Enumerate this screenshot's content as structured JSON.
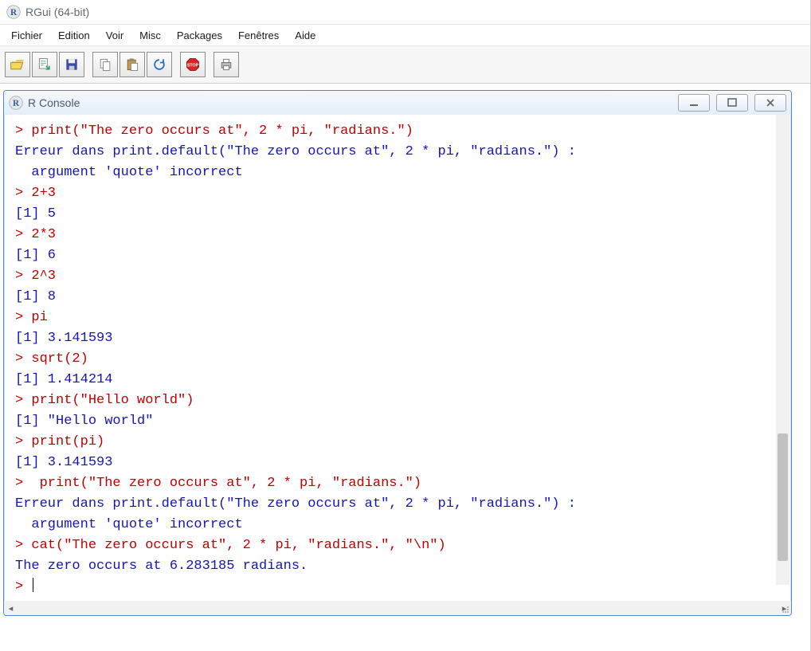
{
  "app": {
    "title": "RGui (64-bit)"
  },
  "menu": [
    "Fichier",
    "Edition",
    "Voir",
    "Misc",
    "Packages",
    "Fenêtres",
    "Aide"
  ],
  "toolbar_icons": [
    "open-icon",
    "source-icon",
    "save-icon",
    "copy-icon",
    "paste-icon",
    "refresh-icon",
    "stop-icon",
    "print-icon"
  ],
  "console_window": {
    "title": "R Console"
  },
  "prompt": "> ",
  "console_lines": [
    {
      "segs": [
        {
          "c": "red",
          "t": "> print(\"The zero occurs at\", 2 * pi, \"radians.\")"
        }
      ]
    },
    {
      "segs": [
        {
          "c": "blue",
          "t": "Erreur dans print.default(\"The zero occurs at\", 2 * pi, \"radians.\") : "
        }
      ]
    },
    {
      "segs": [
        {
          "c": "blue",
          "t": "  argument 'quote' incorrect"
        }
      ]
    },
    {
      "segs": [
        {
          "c": "red",
          "t": "> 2+3"
        }
      ]
    },
    {
      "segs": [
        {
          "c": "blue",
          "t": "[1] 5"
        }
      ]
    },
    {
      "segs": [
        {
          "c": "red",
          "t": "> 2*3"
        }
      ]
    },
    {
      "segs": [
        {
          "c": "blue",
          "t": "[1] 6"
        }
      ]
    },
    {
      "segs": [
        {
          "c": "red",
          "t": "> 2^3"
        }
      ]
    },
    {
      "segs": [
        {
          "c": "blue",
          "t": "[1] 8"
        }
      ]
    },
    {
      "segs": [
        {
          "c": "red",
          "t": "> pi"
        }
      ]
    },
    {
      "segs": [
        {
          "c": "blue",
          "t": "[1] 3.141593"
        }
      ]
    },
    {
      "segs": [
        {
          "c": "red",
          "t": "> sqrt(2)"
        }
      ]
    },
    {
      "segs": [
        {
          "c": "blue",
          "t": "[1] 1.414214"
        }
      ]
    },
    {
      "segs": [
        {
          "c": "red",
          "t": "> print(\"Hello world\")"
        }
      ]
    },
    {
      "segs": [
        {
          "c": "blue",
          "t": "[1] \"Hello world\""
        }
      ]
    },
    {
      "segs": [
        {
          "c": "red",
          "t": "> print(pi)"
        }
      ]
    },
    {
      "segs": [
        {
          "c": "blue",
          "t": "[1] 3.141593"
        }
      ]
    },
    {
      "segs": [
        {
          "c": "red",
          "t": ">  print(\"The zero occurs at\", 2 * pi, \"radians.\")"
        }
      ]
    },
    {
      "segs": [
        {
          "c": "blue",
          "t": "Erreur dans print.default(\"The zero occurs at\", 2 * pi, \"radians.\") : "
        }
      ]
    },
    {
      "segs": [
        {
          "c": "blue",
          "t": "  argument 'quote' incorrect"
        }
      ]
    },
    {
      "segs": [
        {
          "c": "red",
          "t": "> cat(\"The zero occurs at\", 2 * pi, \"radians.\", \"\\n\")"
        }
      ]
    },
    {
      "segs": [
        {
          "c": "blue",
          "t": "The zero occurs at 6.283185 radians. "
        }
      ]
    },
    {
      "segs": [
        {
          "c": "red",
          "t": "> "
        }
      ],
      "cursor": true
    }
  ]
}
